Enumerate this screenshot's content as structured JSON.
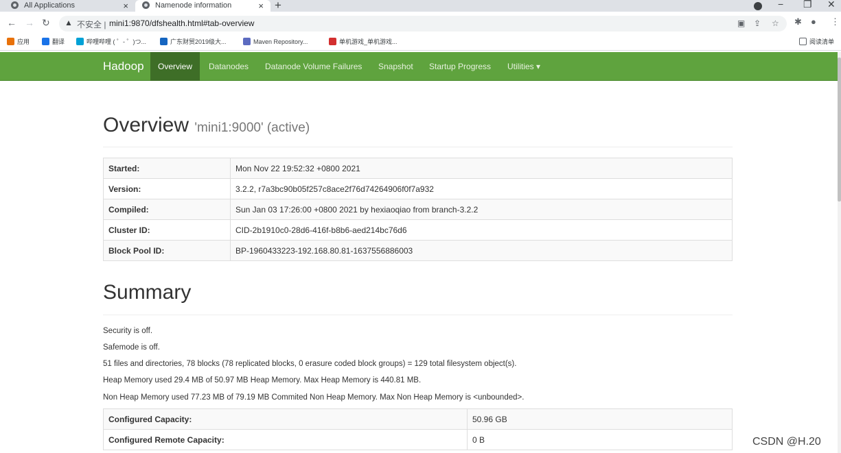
{
  "browser": {
    "tabs": [
      {
        "title": "All Applications"
      },
      {
        "title": "Namenode information"
      }
    ],
    "new_tab": "+",
    "close": "×",
    "url_prefix": "不安全 |",
    "url": "mini1:9870/dfshealth.html#tab-overview",
    "bookmarks": [
      {
        "label": "应用",
        "color": "#e8710a"
      },
      {
        "label": "翻译",
        "color": "#1a73e8"
      },
      {
        "label": "哔哩哔哩 ( ゜- ゜)つ...",
        "color": "#00a1d6"
      },
      {
        "label": "广东财贸2019级大...",
        "color": "#1565c0"
      },
      {
        "label": "Maven Repository...",
        "color": "#5c6bc0"
      },
      {
        "label": "单机游戏_单机游戏...",
        "color": "#d32f2f"
      }
    ],
    "reading_list": "阅读清单"
  },
  "navbar": {
    "brand": "Hadoop",
    "items": [
      {
        "label": "Overview",
        "active": true
      },
      {
        "label": "Datanodes"
      },
      {
        "label": "Datanode Volume Failures"
      },
      {
        "label": "Snapshot"
      },
      {
        "label": "Startup Progress"
      },
      {
        "label": "Utilities ▾"
      }
    ],
    "color": "#5fa33e"
  },
  "overview": {
    "title": "Overview",
    "subtitle": "'mini1:9000' (active)",
    "rows": [
      {
        "key": "Started:",
        "value": "Mon Nov 22 19:52:32 +0800 2021"
      },
      {
        "key": "Version:",
        "value": "3.2.2, r7a3bc90b05f257c8ace2f76d74264906f0f7a932"
      },
      {
        "key": "Compiled:",
        "value": "Sun Jan 03 17:26:00 +0800 2021 by hexiaoqiao from branch-3.2.2"
      },
      {
        "key": "Cluster ID:",
        "value": "CID-2b1910c0-28d6-416f-b8b6-aed214bc76d6"
      },
      {
        "key": "Block Pool ID:",
        "value": "BP-1960433223-192.168.80.81-1637556886003"
      }
    ]
  },
  "summary": {
    "title": "Summary",
    "lines": [
      "Security is off.",
      "Safemode is off.",
      "51 files and directories, 78 blocks (78 replicated blocks, 0 erasure coded block groups) = 129 total filesystem object(s).",
      "Heap Memory used 29.4 MB of 50.97 MB Heap Memory. Max Heap Memory is 440.81 MB.",
      "Non Heap Memory used 77.23 MB of 79.19 MB Commited Non Heap Memory. Max Non Heap Memory is <unbounded>."
    ],
    "rows": [
      {
        "key": "Configured Capacity:",
        "value": "50.96 GB"
      },
      {
        "key": "Configured Remote Capacity:",
        "value": "0 B"
      }
    ]
  },
  "watermark": "CSDN @H.20"
}
